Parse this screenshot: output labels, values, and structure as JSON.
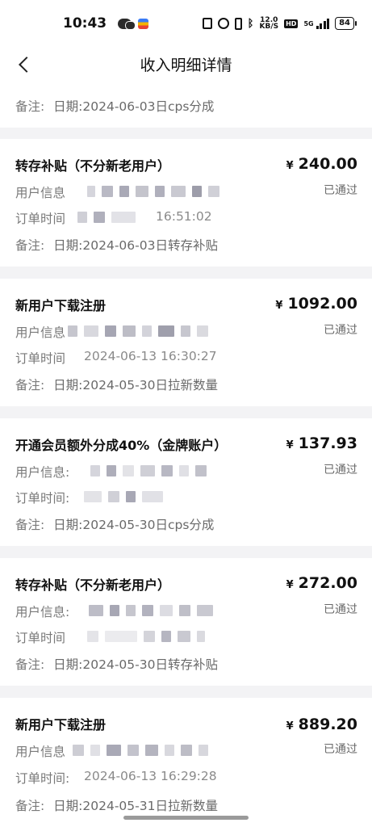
{
  "status_bar": {
    "time": "10:43",
    "speed_top": "12.0",
    "speed_bottom": "KB/S",
    "network": "5G",
    "hd": "HD",
    "battery": "84"
  },
  "nav": {
    "title": "收入明细详情",
    "back_icon": "chevron-left-icon"
  },
  "top_partial": {
    "remark_label": "备注:",
    "remark_value": "日期:2024-06-03日cps分成"
  },
  "labels": {
    "user_info": "用户信息",
    "order_time": "订单时间",
    "remark": "备注:"
  },
  "records": [
    {
      "title": "转存补贴（不分新老用户）",
      "currency": "¥",
      "amount": "240.00",
      "status": "已通过",
      "order_time_visible": "16:51:02",
      "remark": "日期:2024-06-03日转存补贴"
    },
    {
      "title": "新用户下载注册",
      "currency": "¥",
      "amount": "1092.00",
      "status": "已通过",
      "order_time_visible": "2024-06-13 16:30:27",
      "remark": "日期:2024-05-30日拉新数量"
    },
    {
      "title": "开通会员额外分成40%（金牌账户）",
      "currency": "¥",
      "amount": "137.93",
      "status": "已通过",
      "order_time_visible": "",
      "remark": "日期:2024-05-30日cps分成"
    },
    {
      "title": "转存补贴（不分新老用户）",
      "currency": "¥",
      "amount": "272.00",
      "status": "已通过",
      "order_time_visible": "",
      "remark": "日期:2024-05-30日转存补贴"
    },
    {
      "title": "新用户下载注册",
      "currency": "¥",
      "amount": "889.20",
      "status": "已通过",
      "order_time_visible": "2024-06-13 16:29:28",
      "remark": "日期:2024-05-31日拉新数量"
    }
  ]
}
